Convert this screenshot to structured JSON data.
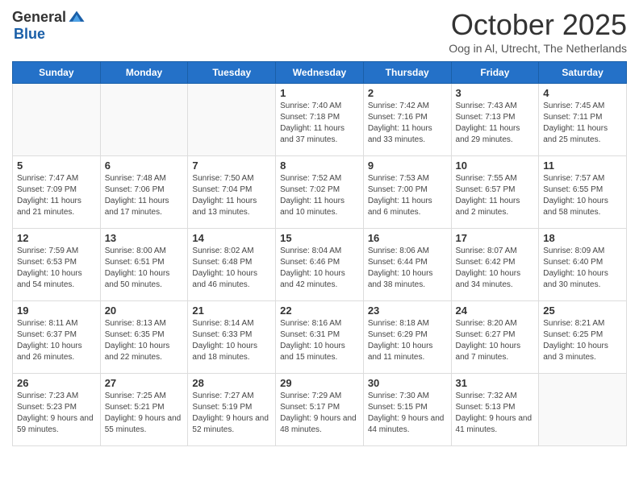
{
  "header": {
    "logo_general": "General",
    "logo_blue": "Blue",
    "month_title": "October 2025",
    "location": "Oog in Al, Utrecht, The Netherlands"
  },
  "days_of_week": [
    "Sunday",
    "Monday",
    "Tuesday",
    "Wednesday",
    "Thursday",
    "Friday",
    "Saturday"
  ],
  "weeks": [
    [
      {
        "day": "",
        "info": ""
      },
      {
        "day": "",
        "info": ""
      },
      {
        "day": "",
        "info": ""
      },
      {
        "day": "1",
        "info": "Sunrise: 7:40 AM\nSunset: 7:18 PM\nDaylight: 11 hours and 37 minutes."
      },
      {
        "day": "2",
        "info": "Sunrise: 7:42 AM\nSunset: 7:16 PM\nDaylight: 11 hours and 33 minutes."
      },
      {
        "day": "3",
        "info": "Sunrise: 7:43 AM\nSunset: 7:13 PM\nDaylight: 11 hours and 29 minutes."
      },
      {
        "day": "4",
        "info": "Sunrise: 7:45 AM\nSunset: 7:11 PM\nDaylight: 11 hours and 25 minutes."
      }
    ],
    [
      {
        "day": "5",
        "info": "Sunrise: 7:47 AM\nSunset: 7:09 PM\nDaylight: 11 hours and 21 minutes."
      },
      {
        "day": "6",
        "info": "Sunrise: 7:48 AM\nSunset: 7:06 PM\nDaylight: 11 hours and 17 minutes."
      },
      {
        "day": "7",
        "info": "Sunrise: 7:50 AM\nSunset: 7:04 PM\nDaylight: 11 hours and 13 minutes."
      },
      {
        "day": "8",
        "info": "Sunrise: 7:52 AM\nSunset: 7:02 PM\nDaylight: 11 hours and 10 minutes."
      },
      {
        "day": "9",
        "info": "Sunrise: 7:53 AM\nSunset: 7:00 PM\nDaylight: 11 hours and 6 minutes."
      },
      {
        "day": "10",
        "info": "Sunrise: 7:55 AM\nSunset: 6:57 PM\nDaylight: 11 hours and 2 minutes."
      },
      {
        "day": "11",
        "info": "Sunrise: 7:57 AM\nSunset: 6:55 PM\nDaylight: 10 hours and 58 minutes."
      }
    ],
    [
      {
        "day": "12",
        "info": "Sunrise: 7:59 AM\nSunset: 6:53 PM\nDaylight: 10 hours and 54 minutes."
      },
      {
        "day": "13",
        "info": "Sunrise: 8:00 AM\nSunset: 6:51 PM\nDaylight: 10 hours and 50 minutes."
      },
      {
        "day": "14",
        "info": "Sunrise: 8:02 AM\nSunset: 6:48 PM\nDaylight: 10 hours and 46 minutes."
      },
      {
        "day": "15",
        "info": "Sunrise: 8:04 AM\nSunset: 6:46 PM\nDaylight: 10 hours and 42 minutes."
      },
      {
        "day": "16",
        "info": "Sunrise: 8:06 AM\nSunset: 6:44 PM\nDaylight: 10 hours and 38 minutes."
      },
      {
        "day": "17",
        "info": "Sunrise: 8:07 AM\nSunset: 6:42 PM\nDaylight: 10 hours and 34 minutes."
      },
      {
        "day": "18",
        "info": "Sunrise: 8:09 AM\nSunset: 6:40 PM\nDaylight: 10 hours and 30 minutes."
      }
    ],
    [
      {
        "day": "19",
        "info": "Sunrise: 8:11 AM\nSunset: 6:37 PM\nDaylight: 10 hours and 26 minutes."
      },
      {
        "day": "20",
        "info": "Sunrise: 8:13 AM\nSunset: 6:35 PM\nDaylight: 10 hours and 22 minutes."
      },
      {
        "day": "21",
        "info": "Sunrise: 8:14 AM\nSunset: 6:33 PM\nDaylight: 10 hours and 18 minutes."
      },
      {
        "day": "22",
        "info": "Sunrise: 8:16 AM\nSunset: 6:31 PM\nDaylight: 10 hours and 15 minutes."
      },
      {
        "day": "23",
        "info": "Sunrise: 8:18 AM\nSunset: 6:29 PM\nDaylight: 10 hours and 11 minutes."
      },
      {
        "day": "24",
        "info": "Sunrise: 8:20 AM\nSunset: 6:27 PM\nDaylight: 10 hours and 7 minutes."
      },
      {
        "day": "25",
        "info": "Sunrise: 8:21 AM\nSunset: 6:25 PM\nDaylight: 10 hours and 3 minutes."
      }
    ],
    [
      {
        "day": "26",
        "info": "Sunrise: 7:23 AM\nSunset: 5:23 PM\nDaylight: 9 hours and 59 minutes."
      },
      {
        "day": "27",
        "info": "Sunrise: 7:25 AM\nSunset: 5:21 PM\nDaylight: 9 hours and 55 minutes."
      },
      {
        "day": "28",
        "info": "Sunrise: 7:27 AM\nSunset: 5:19 PM\nDaylight: 9 hours and 52 minutes."
      },
      {
        "day": "29",
        "info": "Sunrise: 7:29 AM\nSunset: 5:17 PM\nDaylight: 9 hours and 48 minutes."
      },
      {
        "day": "30",
        "info": "Sunrise: 7:30 AM\nSunset: 5:15 PM\nDaylight: 9 hours and 44 minutes."
      },
      {
        "day": "31",
        "info": "Sunrise: 7:32 AM\nSunset: 5:13 PM\nDaylight: 9 hours and 41 minutes."
      },
      {
        "day": "",
        "info": ""
      }
    ]
  ]
}
